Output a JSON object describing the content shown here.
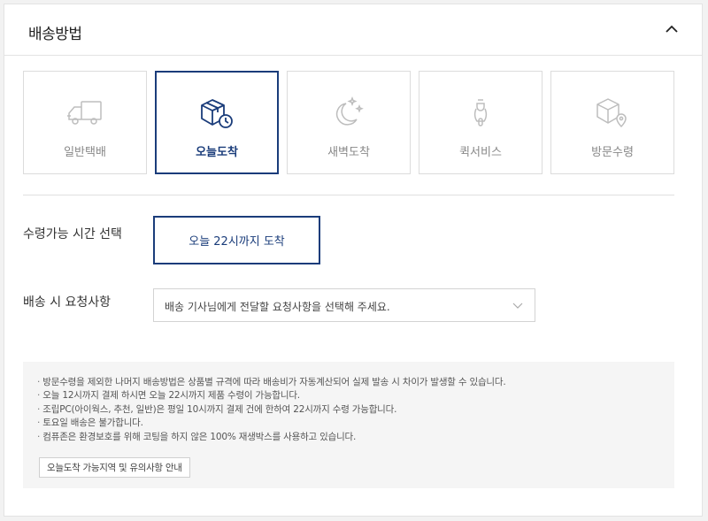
{
  "section": {
    "title": "배송방법"
  },
  "methods": [
    {
      "label": "일반택배",
      "icon": "truck-icon",
      "selected": false
    },
    {
      "label": "오늘도착",
      "icon": "box-clock-icon",
      "selected": true
    },
    {
      "label": "새벽도착",
      "icon": "moon-stars-icon",
      "selected": false
    },
    {
      "label": "퀵서비스",
      "icon": "scooter-icon",
      "selected": false
    },
    {
      "label": "방문수령",
      "icon": "box-location-icon",
      "selected": false
    }
  ],
  "time_selection": {
    "label": "수령가능 시간 선택",
    "option": "오늘 22시까지 도착"
  },
  "delivery_request": {
    "label": "배송 시 요청사항",
    "placeholder": "배송 기사님에게 전달할 요청사항을 선택해 주세요."
  },
  "notices": [
    "방문수령을 제외한 나머지 배송방법은 상품별 규격에 따라 배송비가 자동계산되어 실제 발송 시 차이가 발생할 수 있습니다.",
    "오늘 12시까지 결제 하시면 오늘 22시까지 제품 수령이 가능합니다.",
    "조립PC(아이웍스, 추천, 일반)은 평일 10시까지 결제 건에 한하여 22시까지 수령 가능합니다.",
    "토요일 배송은 불가합니다.",
    "컴퓨존은 환경보호를 위해 코팅을 하지 않은 100% 재생박스를 사용하고 있습니다."
  ],
  "guide_button": "오늘도착 가능지역 및 유의사항 안내",
  "colors": {
    "accent": "#1a3c7a",
    "inactive_icon": "#bdbdbd",
    "border": "#dcdcdc"
  }
}
